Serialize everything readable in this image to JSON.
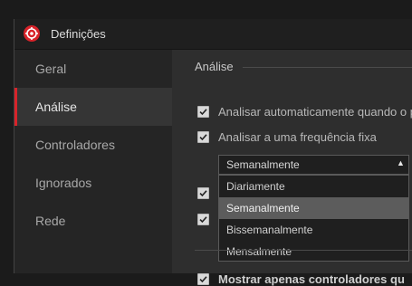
{
  "window": {
    "title": "Definições",
    "app_icon": "app-logo-icon"
  },
  "sidebar": {
    "items": [
      {
        "label": "Geral",
        "active": false
      },
      {
        "label": "Análise",
        "active": true
      },
      {
        "label": "Controladores",
        "active": false
      },
      {
        "label": "Ignorados",
        "active": false
      },
      {
        "label": "Rede",
        "active": false
      }
    ]
  },
  "content": {
    "section_title": "Análise",
    "options": [
      {
        "label": "Analisar automaticamente quando o p",
        "checked": true
      },
      {
        "label": "Analisar a uma frequência fixa",
        "checked": true
      },
      {
        "label": "",
        "checked": true
      },
      {
        "label": "",
        "checked": true
      },
      {
        "label": "Mostrar apenas controladores qu",
        "checked": true
      }
    ],
    "frequency_select": {
      "value": "Semanalmente",
      "options": [
        "Diariamente",
        "Semanalmente",
        "Bissemanalmente",
        "Mensalmente"
      ],
      "highlighted": "Semanalmente"
    }
  },
  "colors": {
    "accent": "#d8232a",
    "background": "#2e2e2e",
    "sidebar": "#252525"
  }
}
